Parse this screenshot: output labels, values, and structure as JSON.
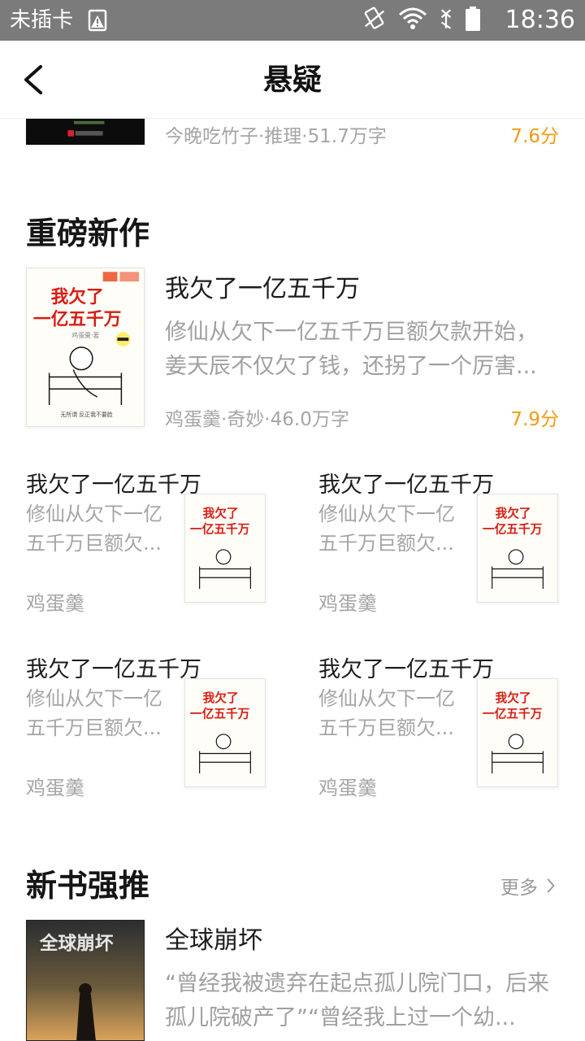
{
  "status_bar": {
    "carrier": "未插卡",
    "time": "18:36",
    "icons": [
      "sim-warning-icon",
      "rotate-icon",
      "wifi-icon",
      "no-signal-icon",
      "battery-icon"
    ]
  },
  "header": {
    "title": "悬疑",
    "back_icon": "chevron-left-icon"
  },
  "top_partial_item": {
    "meta": "今晚吃竹子·推理·51.7万字",
    "score": "7.6分"
  },
  "section_new": {
    "title": "重磅新作",
    "featured": {
      "title": "我欠了一亿五千万",
      "description": "修仙从欠下一亿五千万巨额欠款开始，姜天辰不仅欠了钱，还拐了一个厉害...",
      "meta": "鸡蛋羹·奇妙·46.0万字",
      "score": "7.9分",
      "cover": {
        "title": "我欠了一亿五千万",
        "author": "鸡蛋羹·著",
        "tagline": "无所谓 反正我不要脸"
      }
    },
    "grid": [
      {
        "title": "我欠了一亿五千万",
        "description": "修仙从欠下一亿五千万巨额欠...",
        "author": "鸡蛋羹"
      },
      {
        "title": "我欠了一亿五千万",
        "description": "修仙从欠下一亿五千万巨额欠...",
        "author": "鸡蛋羹"
      },
      {
        "title": "我欠了一亿五千万",
        "description": "修仙从欠下一亿五千万巨额欠...",
        "author": "鸡蛋羹"
      },
      {
        "title": "我欠了一亿五千万",
        "description": "修仙从欠下一亿五千万巨额欠...",
        "author": "鸡蛋羹"
      }
    ]
  },
  "section_push": {
    "title": "新书强推",
    "more_label": "更多",
    "featured": {
      "title": "全球崩坏",
      "description": "“曾经我被遗弃在起点孤儿院门口，后来孤儿院破产了”“曾经我上过一个幼...",
      "cover": {
        "title": "全球崩坏"
      }
    }
  },
  "colors": {
    "accent_score": "#f39a12",
    "muted_text": "#a5a5a5",
    "status_bar": "#7b7b7b"
  }
}
